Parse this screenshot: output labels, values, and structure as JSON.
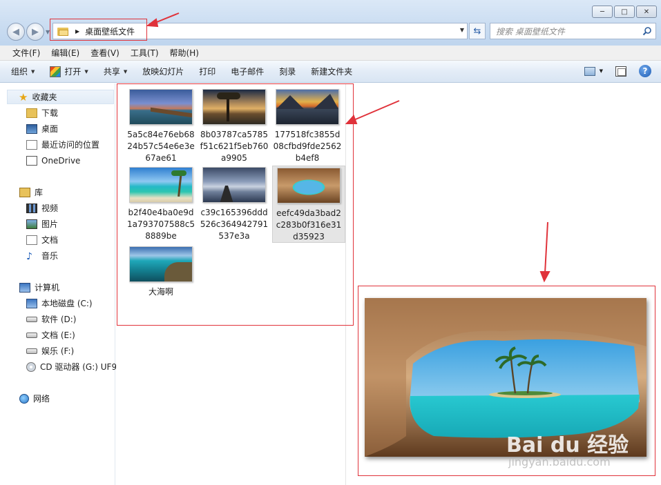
{
  "window": {
    "minimize": "─",
    "maximize": "□",
    "close": "✕"
  },
  "address": {
    "path": "桌面壁纸文件",
    "search_placeholder": "搜索 桌面壁纸文件"
  },
  "menu": [
    "文件(F)",
    "编辑(E)",
    "查看(V)",
    "工具(T)",
    "帮助(H)"
  ],
  "toolbar": {
    "organize": "组织",
    "open": "打开",
    "share": "共享",
    "slideshow": "放映幻灯片",
    "print": "打印",
    "email": "电子邮件",
    "burn": "刻录",
    "new_folder": "新建文件夹"
  },
  "nav": {
    "favorites": "收藏夹",
    "downloads": "下载",
    "desktop": "桌面",
    "recent": "最近访问的位置",
    "onedrive": "OneDrive",
    "libraries": "库",
    "videos": "视频",
    "pictures": "图片",
    "documents": "文档",
    "music": "音乐",
    "computer": "计算机",
    "drive_c": "本地磁盘 (C:)",
    "drive_d": "软件 (D:)",
    "drive_e": "文档 (E:)",
    "drive_f": "娱乐 (F:)",
    "drive_g": "CD 驱动器 (G:) UF9",
    "network": "网络"
  },
  "files": [
    {
      "name": "5a5c84e76eb6824b57c54e6e3e67ae61",
      "theme": "pier-dusk"
    },
    {
      "name": "8b03787ca5785f51c621f5eb760a9905",
      "theme": "tree-lake"
    },
    {
      "name": "177518fc3855d08cfbd9fde2562b4ef8",
      "theme": "mountain-sunset"
    },
    {
      "name": "b2f40e4ba0e9d1a793707588c58889be",
      "theme": "palm-beach"
    },
    {
      "name": "c39c165396ddd526c364942791537e3a",
      "theme": "dock-calm"
    },
    {
      "name": "eefc49da3bad2c283b0f316e31d35923",
      "theme": "cave-island",
      "selected": true
    },
    {
      "name": "大海啊",
      "theme": "sea-coast"
    }
  ],
  "watermark": {
    "brand": "Bai du 经验",
    "url": "jingyan.baidu.com"
  }
}
